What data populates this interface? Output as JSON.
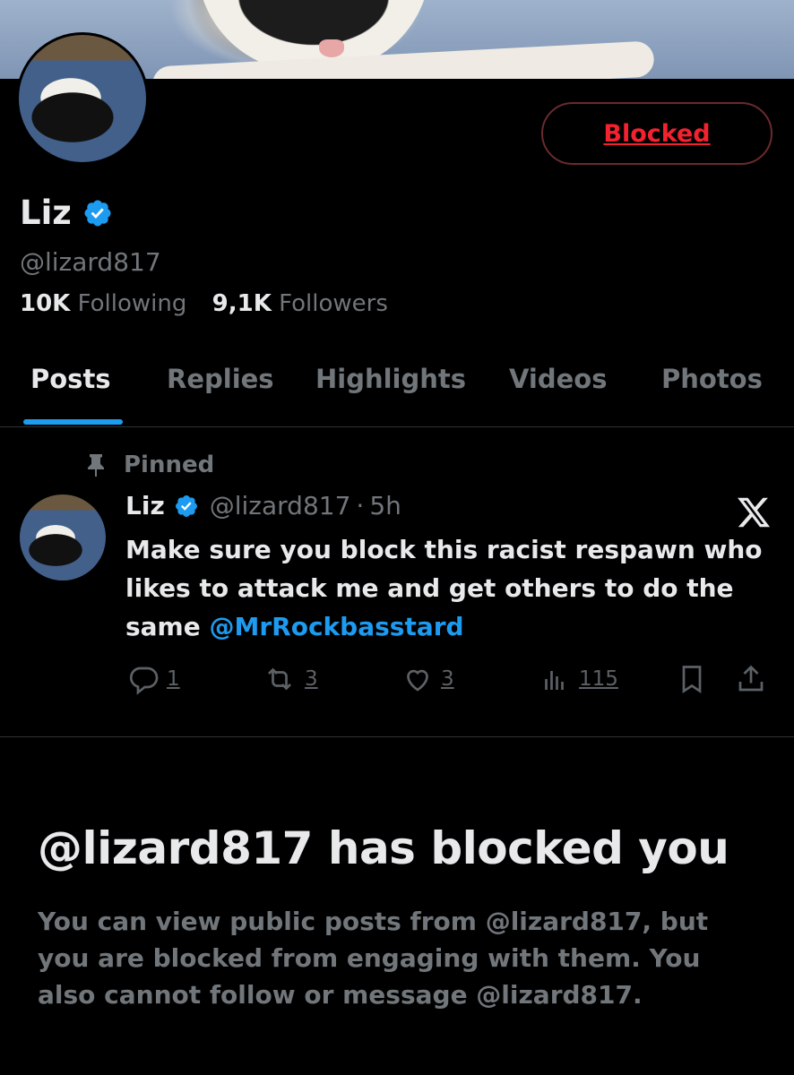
{
  "profile": {
    "blocked_button": "Blocked",
    "name": "Liz",
    "handle": "@lizard817",
    "following_count": "10K",
    "following_label": "Following",
    "followers_count": "9,1K",
    "followers_label": "Followers"
  },
  "tabs": [
    {
      "label": "Posts",
      "active": true
    },
    {
      "label": "Replies",
      "active": false
    },
    {
      "label": "Highlights",
      "active": false
    },
    {
      "label": "Videos",
      "active": false
    },
    {
      "label": "Photos",
      "active": false
    }
  ],
  "post": {
    "pinned_label": "Pinned",
    "author_name": "Liz",
    "author_handle": "@lizard817",
    "separator": "·",
    "time": "5h",
    "text": "Make sure you block this racist respawn who likes to attack me and get others to do the same",
    "mention": "@MrRockbasstard",
    "replies": "1",
    "reposts": "3",
    "likes": "3",
    "views": "115"
  },
  "blocked_notice": {
    "title": "@lizard817 has blocked you",
    "description": "You can view public posts from @lizard817, but you are blocked from engaging with them. You also cannot follow or message @lizard817."
  },
  "colors": {
    "accent": "#1d9bf0",
    "blocked_red": "#f4212e",
    "muted_text": "#71767b",
    "background": "#000000"
  }
}
